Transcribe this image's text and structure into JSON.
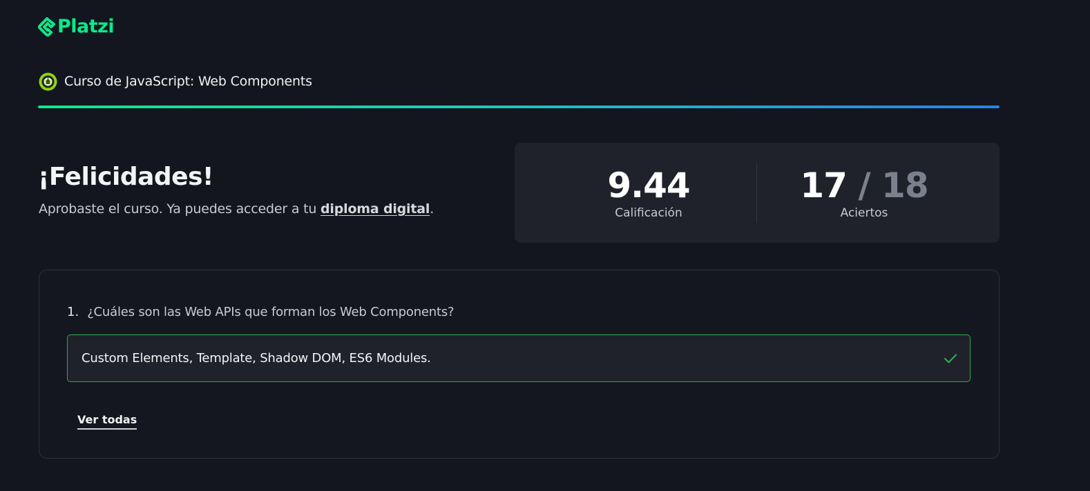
{
  "brand": {
    "logo_text": "Platzi",
    "accent_color": "#0ae98a"
  },
  "course": {
    "icon": "web-components-badge-icon",
    "title": "Curso de JavaScript: Web Components",
    "progress_fraction": 1.0
  },
  "result": {
    "title": "¡Felicidades!",
    "message_prefix": "Aprobaste el curso. Ya puedes acceder a tu ",
    "diploma_link": "diploma digital",
    "message_suffix": "."
  },
  "score": {
    "grade": "9.44",
    "grade_label": "Calificación",
    "correct": "17",
    "total": "/ 18",
    "correct_label": "Aciertos"
  },
  "question": {
    "number": "1.",
    "text": "¿Cuáles son las Web APIs que forman los Web Components?",
    "answer": "Custom Elements, Template, Shadow DOM, ES6 Modules.",
    "status_icon": "check-icon",
    "status_color": "#2eaa52"
  },
  "actions": {
    "see_all": "Ver todas"
  }
}
